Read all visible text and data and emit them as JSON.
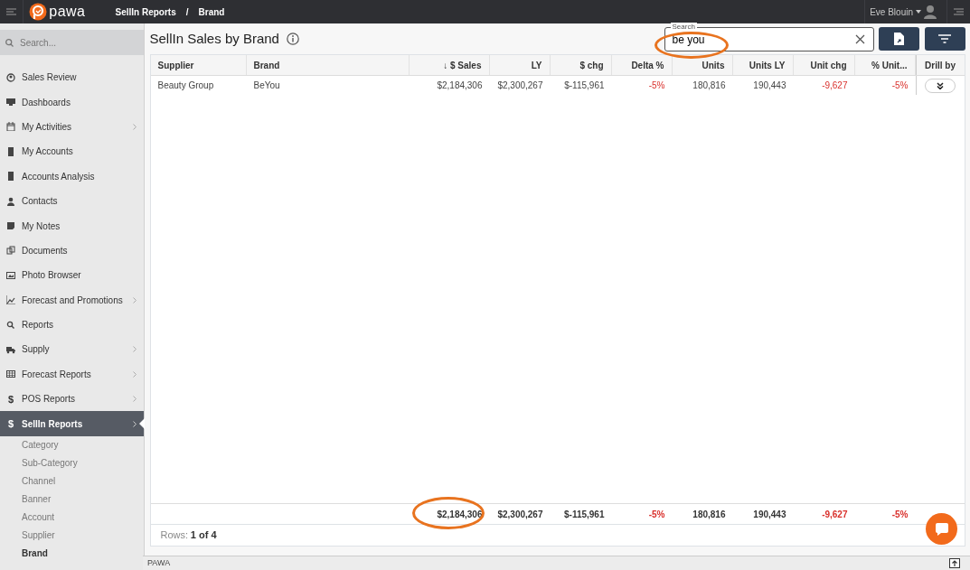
{
  "topbar": {
    "brand": "pawa",
    "breadcrumb": [
      "SellIn Reports",
      "Brand"
    ],
    "breadcrumb_separator": "/",
    "user": "Eve Blouin"
  },
  "sidebar": {
    "search_placeholder": "Search...",
    "items": [
      {
        "label": "Sales Review",
        "selected": false
      },
      {
        "label": "Dashboards",
        "selected": false
      },
      {
        "label": "My Activities",
        "has_submenu": true,
        "selected": false
      },
      {
        "label": "My Accounts",
        "selected": false
      },
      {
        "label": "Accounts Analysis",
        "selected": false
      },
      {
        "label": "Contacts",
        "selected": false
      },
      {
        "label": "My Notes",
        "selected": false
      },
      {
        "label": "Documents",
        "selected": false
      },
      {
        "label": "Photo Browser",
        "selected": false
      },
      {
        "label": "Forecast and Promotions",
        "has_submenu": true,
        "selected": false
      },
      {
        "label": "Reports",
        "selected": false
      },
      {
        "label": "Supply",
        "has_submenu": true,
        "selected": false
      },
      {
        "label": "Forecast Reports",
        "has_submenu": true,
        "selected": false
      },
      {
        "label": "POS Reports",
        "icon_text": "$",
        "has_submenu": true,
        "selected": false
      },
      {
        "label": "SellIn Reports",
        "icon_text": "$",
        "has_submenu": true,
        "selected": true,
        "children": [
          {
            "label": "Category",
            "selected": false
          },
          {
            "label": "Sub-Category",
            "selected": false
          },
          {
            "label": "Channel",
            "selected": false
          },
          {
            "label": "Banner",
            "selected": false
          },
          {
            "label": "Account",
            "selected": false
          },
          {
            "label": "Supplier",
            "selected": false
          },
          {
            "label": "Brand",
            "selected": true
          }
        ]
      }
    ]
  },
  "page": {
    "title": "SellIn Sales by Brand",
    "search": {
      "label": "Search",
      "value": "be you",
      "highlighted": true
    }
  },
  "table": {
    "columns": [
      {
        "label": "Supplier"
      },
      {
        "label": "Brand"
      },
      {
        "label": "↓ $ Sales"
      },
      {
        "label": "LY"
      },
      {
        "label": "$ chg"
      },
      {
        "label": "Delta %"
      },
      {
        "label": "Units"
      },
      {
        "label": "Units LY"
      },
      {
        "label": "Unit chg"
      },
      {
        "label": "% Unit..."
      },
      {
        "label": "Drill by"
      }
    ],
    "rows": [
      [
        {
          "text": "Beauty Group"
        },
        {
          "text": "BeYou"
        },
        {
          "text": "$2,184,306"
        },
        {
          "text": "$2,300,267"
        },
        {
          "text": "$-115,961"
        },
        {
          "text": "-5%",
          "negative": true
        },
        {
          "text": "180,816"
        },
        {
          "text": "190,443"
        },
        {
          "text": "-9,627",
          "negative": true
        },
        {
          "text": "-5%",
          "negative": true
        }
      ]
    ],
    "totals": [
      {
        "text": "$2,184,306",
        "highlighted": true
      },
      {
        "text": "$2,300,267"
      },
      {
        "text": "$-115,961"
      },
      {
        "text": "-5%",
        "negative": true
      },
      {
        "text": "180,816"
      },
      {
        "text": "190,443"
      },
      {
        "text": "-9,627",
        "negative": true
      },
      {
        "text": "-5%",
        "negative": true
      }
    ],
    "rows_label": "Rows:",
    "rows_count": "1 of 4"
  },
  "footer": {
    "text": "PAWA"
  }
}
